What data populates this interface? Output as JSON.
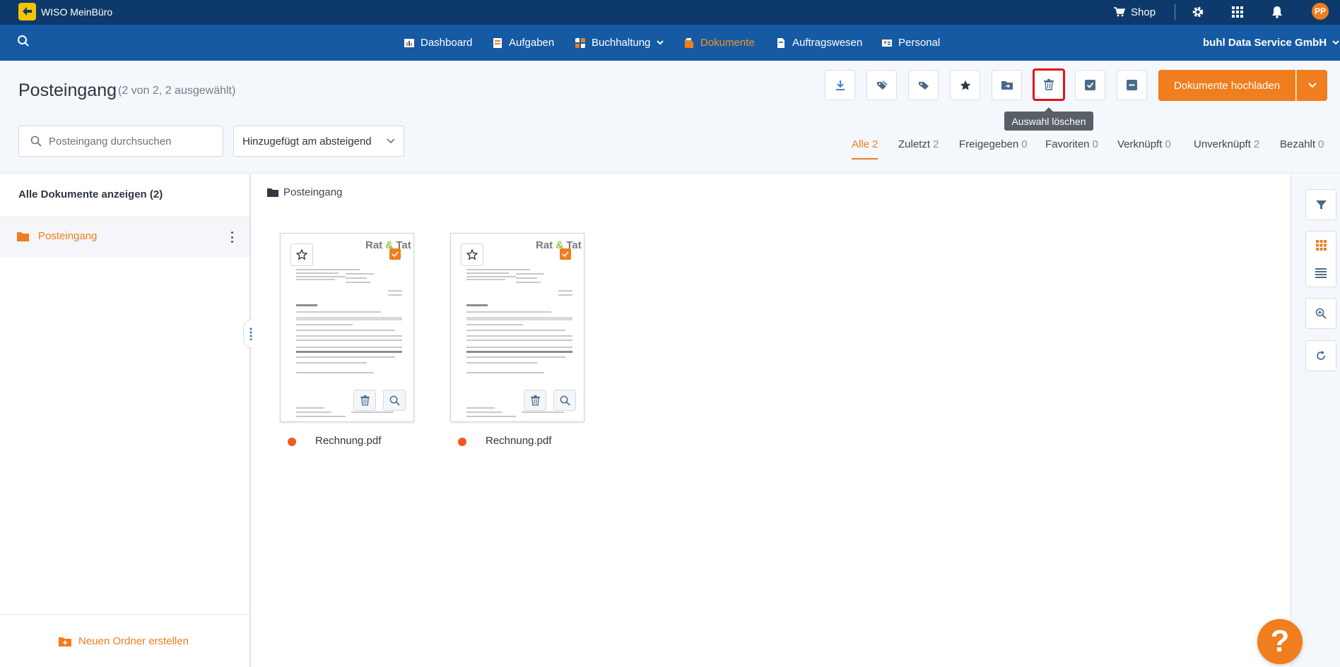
{
  "topbar": {
    "app_name": "WISO MeinBüro",
    "shop_label": "Shop",
    "avatar_initials": "PP"
  },
  "nav": {
    "items": [
      {
        "label": "Dashboard",
        "icon": "dashboard-icon"
      },
      {
        "label": "Aufgaben",
        "icon": "tasks-icon"
      },
      {
        "label": "Buchhaltung",
        "icon": "accounting-icon"
      },
      {
        "label": "Dokumente",
        "icon": "documents-icon",
        "active": true
      },
      {
        "label": "Auftragswesen",
        "icon": "orders-icon"
      },
      {
        "label": "Personal",
        "icon": "personnel-icon"
      }
    ],
    "company": "buhl Data Service GmbH"
  },
  "header": {
    "title": "Posteingang",
    "subtitle": "(2 von 2, 2 ausgewählt)",
    "upload_label": "Dokumente hochladen",
    "tooltip": "Auswahl löschen",
    "toolbar_icons": [
      "download-icon",
      "tag-icon",
      "tag-filled-icon",
      "star-icon",
      "move-folder-icon",
      "trash-icon",
      "select-all-icon",
      "deselect-icon"
    ]
  },
  "search": {
    "placeholder": "Posteingang durchsuchen",
    "value": ""
  },
  "sort": {
    "selected": "Hinzugefügt am absteigend"
  },
  "filters": [
    {
      "label": "Alle",
      "count": "2",
      "active": true
    },
    {
      "label": "Zuletzt",
      "count": "2"
    },
    {
      "label": "Freigegeben",
      "count": "0"
    },
    {
      "label": "Favoriten",
      "count": "0"
    },
    {
      "label": "Verknüpft",
      "count": "0"
    },
    {
      "label": "Unverknüpft",
      "count": "2"
    },
    {
      "label": "Bezahlt",
      "count": "0"
    }
  ],
  "sidebar": {
    "all_docs": "Alle Dokumente anzeigen (2)",
    "folders": [
      {
        "label": "Posteingang"
      }
    ],
    "new_folder": "Neuen Ordner erstellen"
  },
  "main": {
    "breadcrumb": "Posteingang",
    "documents": [
      {
        "name": "Rechnung.pdf",
        "brand": "Rat & Tat",
        "selected": true
      },
      {
        "name": "Rechnung.pdf",
        "brand": "Rat & Tat",
        "selected": true
      }
    ]
  },
  "colors": {
    "topbar": "#0d3a6b",
    "navbar": "#165aa3",
    "accent": "#f07d1e",
    "highlight": "#e3131d"
  },
  "help": {
    "label": "?"
  }
}
